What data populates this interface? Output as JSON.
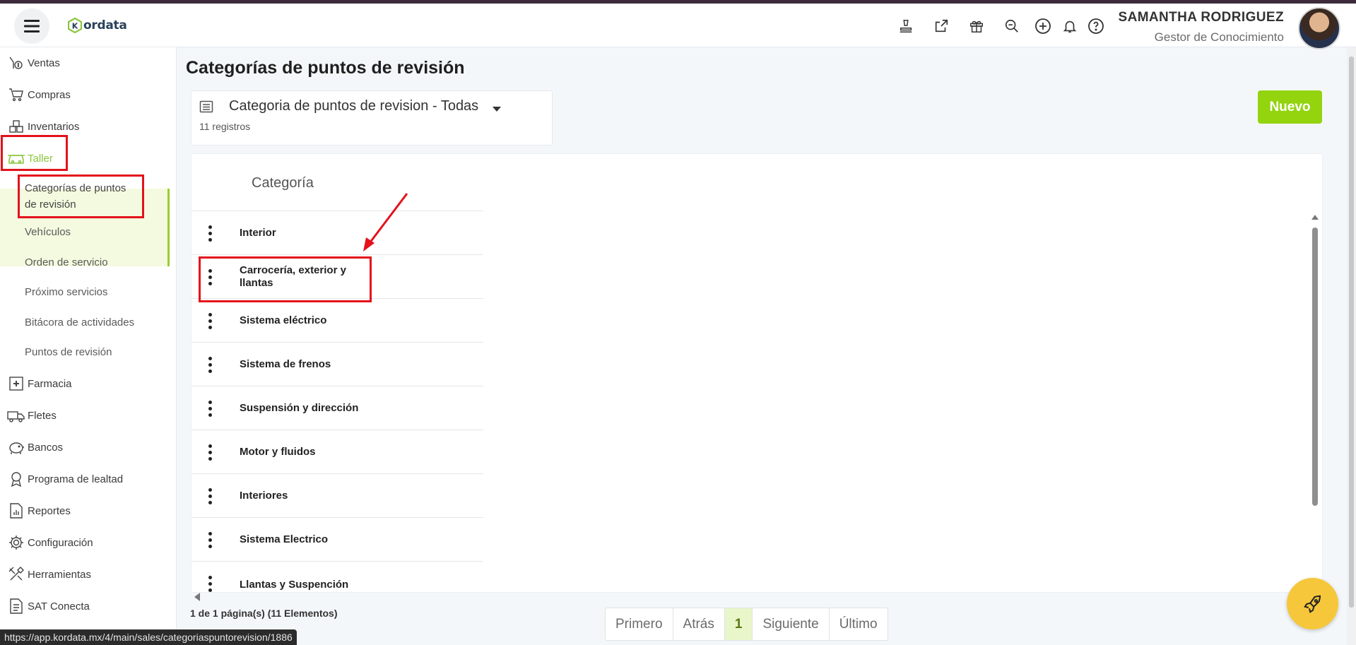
{
  "header": {
    "logo_text": "ordata",
    "logo_letter": "K",
    "user_name": "SAMANTHA RODRIGUEZ",
    "user_role": "Gestor de Conocimiento",
    "icons": [
      "stamp-icon",
      "external-link-icon",
      "gift-icon",
      "search-zoom-icon",
      "add-circle-icon",
      "bell-icon",
      "help-icon"
    ]
  },
  "sidebar": {
    "items": [
      {
        "label": "Ventas",
        "icon": "sales-icon"
      },
      {
        "label": "Compras",
        "icon": "cart-icon"
      },
      {
        "label": "Inventarios",
        "icon": "boxes-icon"
      },
      {
        "label": "Taller",
        "icon": "car-icon"
      },
      {
        "label": "Farmacia",
        "icon": "pharmacy-icon"
      },
      {
        "label": "Fletes",
        "icon": "truck-icon"
      },
      {
        "label": "Bancos",
        "icon": "piggy-bank-icon"
      },
      {
        "label": "Programa de lealtad",
        "icon": "loyalty-icon"
      },
      {
        "label": "Reportes",
        "icon": "report-icon"
      },
      {
        "label": "Configuración",
        "icon": "gear-icon"
      },
      {
        "label": "Herramientas",
        "icon": "tools-icon"
      },
      {
        "label": "SAT Conecta",
        "icon": "document-icon"
      }
    ],
    "taller_sub": [
      "Categorías de puntos de revisión",
      "Vehículos",
      "Orden de servicio",
      "Próximo servicios",
      "Bitácora de actividades",
      "Puntos de revisión"
    ]
  },
  "main": {
    "title": "Categorías de puntos de revisión",
    "filter_label": "Categoria de puntos de revision - Todas",
    "records": "11 registros",
    "new_button": "Nuevo",
    "column_header": "Categoría",
    "rows": [
      "Interior",
      "Carrocería, exterior y llantas",
      "Sistema eléctrico",
      "Sistema de frenos",
      "Suspensión y dirección",
      "Motor y fluidos",
      "Interiores",
      "Sistema Electrico",
      "Llantas y Suspención"
    ],
    "pagination_info": "1 de 1 página(s) (11 Elementos)",
    "pager": [
      "Primero",
      "Atrás",
      "1",
      "Siguiente",
      "Último"
    ]
  },
  "status_url": "https://app.kordata.mx/4/main/sales/categoriaspuntorevision/1886",
  "colors": {
    "accent": "#93d40f",
    "highlight": "#e3121b",
    "fab": "#f6c73a"
  }
}
